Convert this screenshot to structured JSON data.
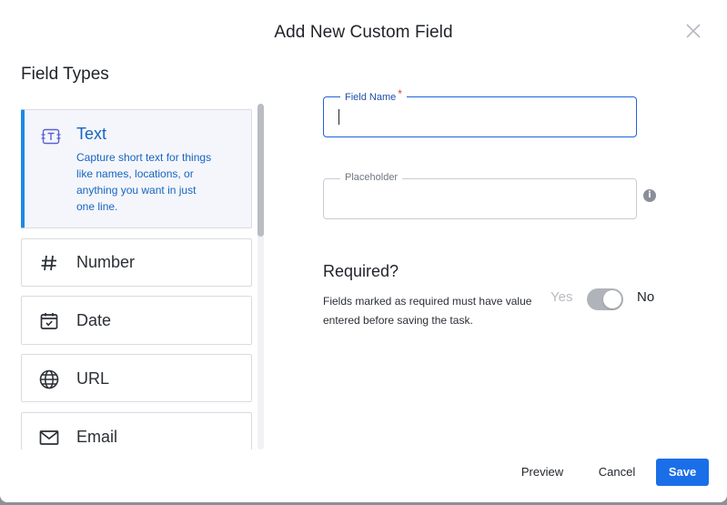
{
  "modal": {
    "title": "Add New Custom Field",
    "close_icon": "close-icon"
  },
  "field_types": {
    "heading": "Field Types",
    "items": [
      {
        "label": "Text",
        "icon": "text-field-icon",
        "description": "Capture short text for things like names, locations, or anything you want in just one line.",
        "selected": true
      },
      {
        "label": "Number",
        "icon": "hash-icon"
      },
      {
        "label": "Date",
        "icon": "calendar-icon"
      },
      {
        "label": "URL",
        "icon": "globe-icon"
      },
      {
        "label": "Email",
        "icon": "envelope-icon"
      }
    ]
  },
  "form": {
    "field_name": {
      "label": "Field Name",
      "required_mark": "*",
      "value": ""
    },
    "placeholder": {
      "label": "Placeholder",
      "value": "",
      "info_icon": "info-icon"
    },
    "required": {
      "heading": "Required?",
      "description": "Fields marked as required must have value entered before saving the task.",
      "yes_label": "Yes",
      "no_label": "No",
      "value": "No"
    }
  },
  "footer": {
    "preview_label": "Preview",
    "cancel_label": "Cancel",
    "save_label": "Save"
  },
  "colors": {
    "accent": "#1a6fe8",
    "selected_text": "#1565c0",
    "required_star": "#e53935",
    "toggle_off": "#b0b4ba"
  }
}
